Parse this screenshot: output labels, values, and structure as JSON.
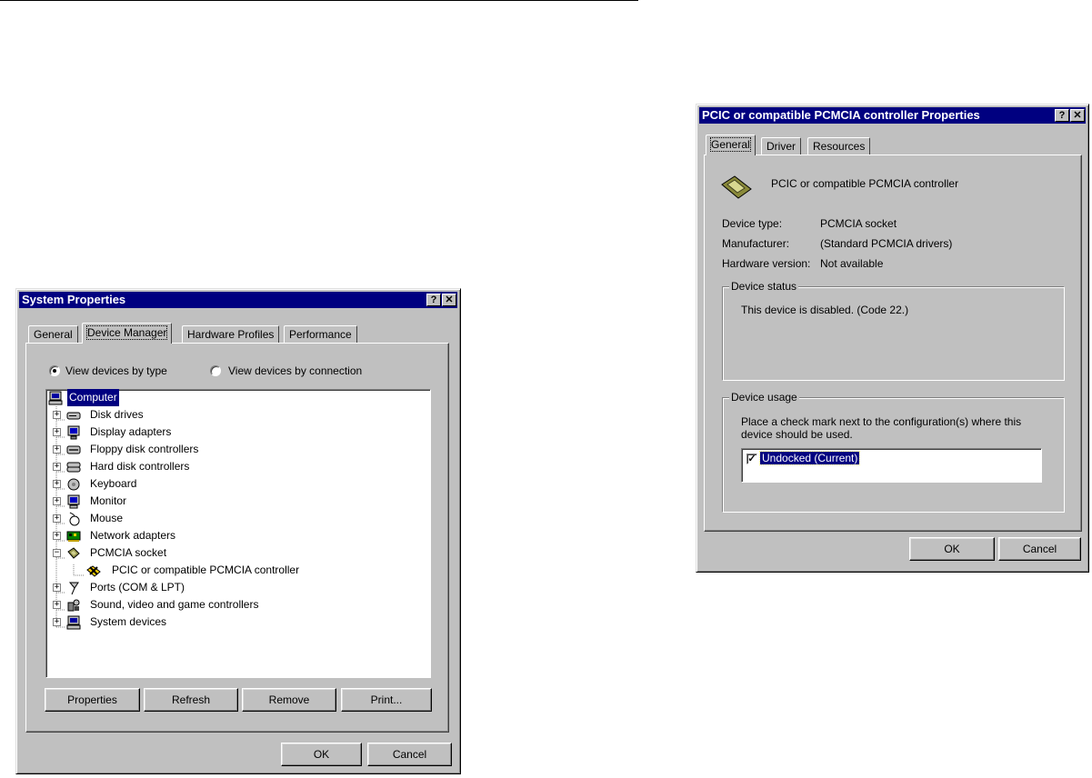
{
  "system_properties": {
    "title": "System Properties",
    "help_btn": "?",
    "close_btn": "✕",
    "tabs": [
      "General",
      "Device Manager",
      "Hardware Profiles",
      "Performance"
    ],
    "view_by_type": "View devices by type",
    "view_by_connection": "View devices by connection",
    "tree": [
      {
        "label": "Computer",
        "icon": "computer-icon"
      },
      {
        "label": "Disk drives",
        "icon": "disk-drive-icon"
      },
      {
        "label": "Display adapters",
        "icon": "display-adapter-icon"
      },
      {
        "label": "Floppy disk controllers",
        "icon": "floppy-controller-icon"
      },
      {
        "label": "Hard disk controllers",
        "icon": "hard-disk-controller-icon"
      },
      {
        "label": "Keyboard",
        "icon": "keyboard-icon"
      },
      {
        "label": "Monitor",
        "icon": "monitor-icon"
      },
      {
        "label": "Mouse",
        "icon": "mouse-icon"
      },
      {
        "label": "Network adapters",
        "icon": "network-adapter-icon"
      },
      {
        "label": "PCMCIA socket",
        "icon": "pcmcia-socket-icon"
      },
      {
        "label": "PCIC or compatible PCMCIA controller",
        "icon": "disabled-device-icon"
      },
      {
        "label": "Ports (COM & LPT)",
        "icon": "ports-icon"
      },
      {
        "label": "Sound, video and game controllers",
        "icon": "sound-icon"
      },
      {
        "label": "System devices",
        "icon": "system-devices-icon"
      }
    ],
    "buttons": {
      "properties": "Properties",
      "refresh": "Refresh",
      "remove": "Remove",
      "print": "Print...",
      "ok": "OK",
      "cancel": "Cancel"
    }
  },
  "pcic_properties": {
    "title": "PCIC or compatible PCMCIA controller Properties",
    "help_btn": "?",
    "close_btn": "✕",
    "tabs": [
      "General",
      "Driver",
      "Resources"
    ],
    "device_name": "PCIC or compatible PCMCIA controller",
    "device_type_label": "Device type:",
    "device_type_value": "PCMCIA socket",
    "manufacturer_label": "Manufacturer:",
    "manufacturer_value": "(Standard PCMCIA drivers)",
    "hw_version_label": "Hardware version:",
    "hw_version_value": "Not available",
    "status_group": "Device status",
    "status_text": "This device is disabled.  (Code 22.)",
    "usage_group": "Device usage",
    "usage_text_1": "Place a check mark next to the configuration(s) where this",
    "usage_text_2": "device should be used.",
    "config_item": "Undocked  (Current)",
    "config_checked": true,
    "buttons": {
      "ok": "OK",
      "cancel": "Cancel"
    }
  }
}
